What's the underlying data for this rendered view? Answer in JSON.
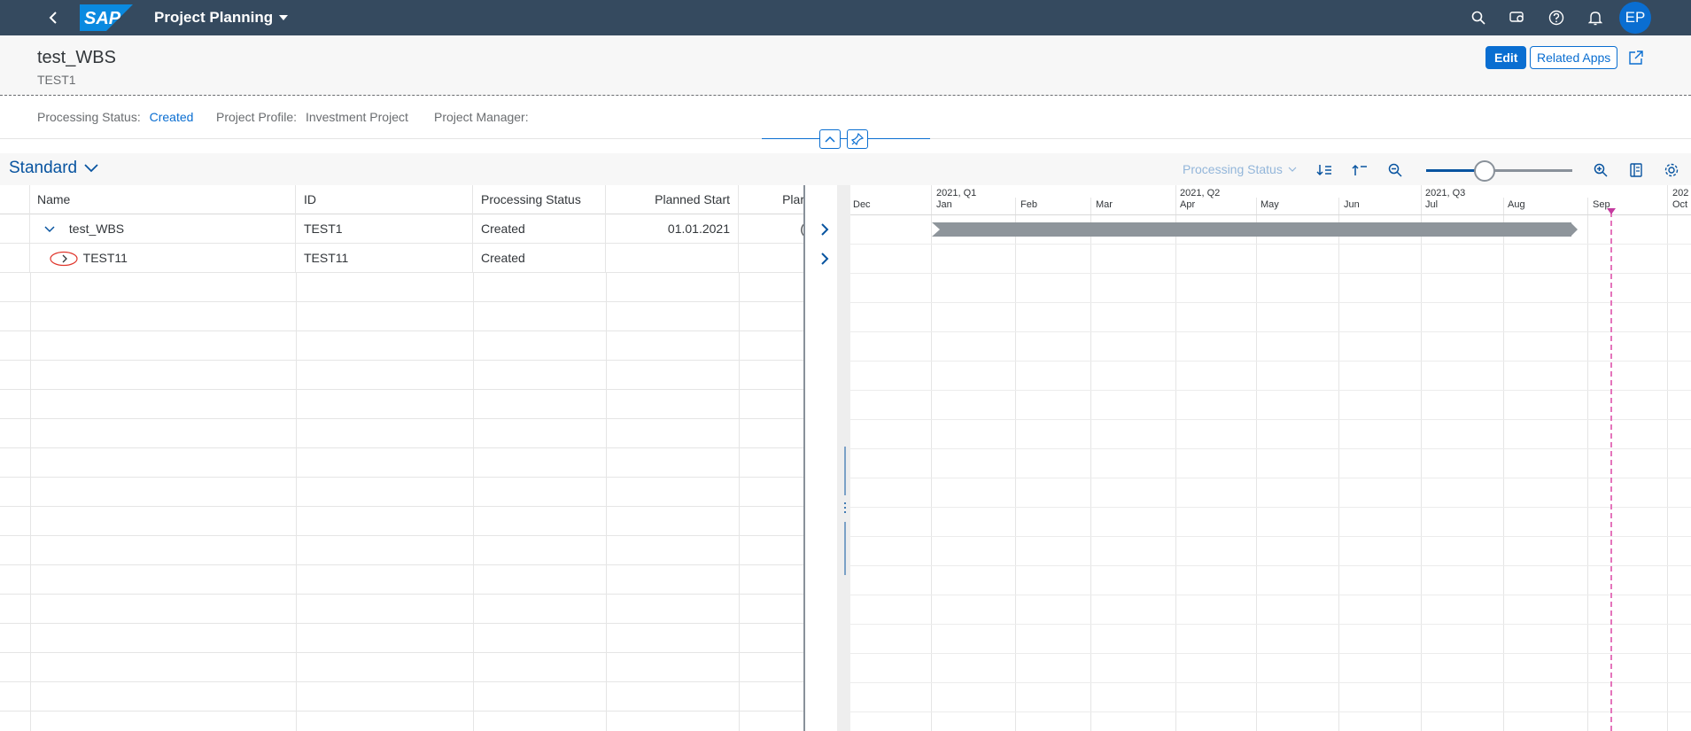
{
  "shell": {
    "app_title": "Project Planning",
    "logo_text": "SAP",
    "avatar_initials": "EP",
    "icons": [
      "back-icon",
      "search-icon",
      "notifications-settings-icon",
      "help-icon",
      "bell-icon"
    ]
  },
  "header": {
    "title": "test_WBS",
    "subtitle": "TEST1",
    "edit_label": "Edit",
    "related_apps_label": "Related Apps"
  },
  "attributes": {
    "processing_status_label": "Processing Status:",
    "processing_status_value": "Created",
    "project_profile_label": "Project Profile:",
    "project_profile_value": "Investment Project",
    "project_manager_label": "Project Manager:",
    "project_manager_value": ""
  },
  "toolbar": {
    "variant": "Standard",
    "group_by_placeholder": "Processing Status",
    "zoom_level": 0.4
  },
  "table": {
    "columns": [
      "Name",
      "ID",
      "Processing Status",
      "Planned Start",
      "Plar"
    ],
    "rows": [
      {
        "name": "test_WBS",
        "id": "TEST1",
        "status": "Created",
        "planned_start": "01.01.2021",
        "planned_finish": "(",
        "expanded": true
      },
      {
        "name": "TEST11",
        "id": "TEST11",
        "status": "Created",
        "planned_start": "",
        "planned_finish": "",
        "expanded": false
      }
    ]
  },
  "timeline": {
    "quarters": [
      "2021, Q1",
      "2021, Q2",
      "2021, Q3",
      "202"
    ],
    "months": [
      "Dec",
      "Jan",
      "Feb",
      "Mar",
      "Apr",
      "May",
      "Jun",
      "Jul",
      "Aug",
      "Sep",
      "Oct"
    ]
  },
  "colors": {
    "shell": "#354a5f",
    "accent": "#0a6ed1",
    "bar": "#8e959b",
    "today_line": "#e474bb"
  }
}
